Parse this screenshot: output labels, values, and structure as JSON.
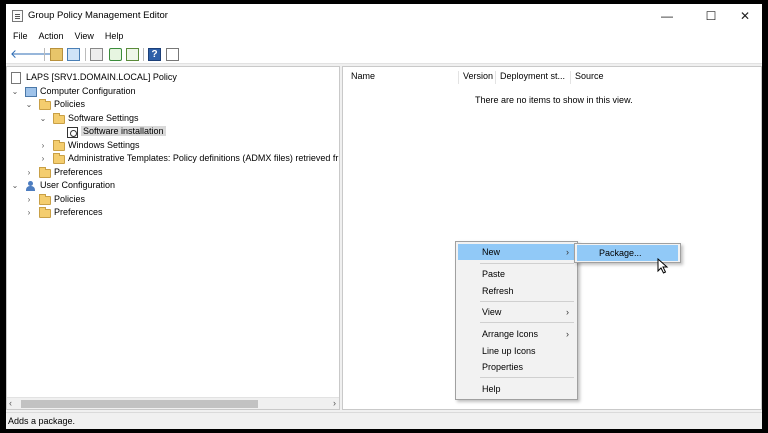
{
  "window": {
    "title": "Group Policy Management Editor",
    "controls": {
      "minimize": "—",
      "maximize": "☐",
      "close": "✕"
    }
  },
  "menubar": {
    "items": [
      "File",
      "Action",
      "View",
      "Help"
    ]
  },
  "toolbar": {
    "buttons": [
      "back-icon",
      "forward-icon",
      "up-folder-icon",
      "show-hide-tree-icon",
      "export-list-icon",
      "refresh-icon",
      "properties-icon",
      "help-icon",
      "view-icon"
    ]
  },
  "tree": {
    "items": [
      {
        "label": "LAPS [SRV1.DOMAIN.LOCAL] Policy",
        "icon": "policy-document-icon"
      },
      {
        "label": "Computer Configuration",
        "icon": "computer-icon",
        "expanded": true
      },
      {
        "label": "Policies",
        "icon": "folder-icon",
        "expanded": true
      },
      {
        "label": "Software Settings",
        "icon": "folder-icon",
        "expanded": true
      },
      {
        "label": "Software installation",
        "icon": "software-package-icon",
        "selected": true
      },
      {
        "label": "Windows Settings",
        "icon": "folder-icon",
        "expanded": false
      },
      {
        "label": "Administrative Templates: Policy definitions (ADMX files) retrieved fr",
        "icon": "folder-icon",
        "expanded": false
      },
      {
        "label": "Preferences",
        "icon": "folder-icon",
        "expanded": false
      },
      {
        "label": "User Configuration",
        "icon": "user-icon",
        "expanded": true
      },
      {
        "label": "Policies",
        "icon": "folder-icon",
        "expanded": false
      },
      {
        "label": "Preferences",
        "icon": "folder-icon",
        "expanded": false
      }
    ],
    "scroll_left": "‹",
    "scroll_right": "›"
  },
  "list": {
    "columns": [
      "Name",
      "Version",
      "Deployment st...",
      "Source"
    ],
    "empty_message": "There are no items to show in this view."
  },
  "context_menu": {
    "items": [
      {
        "label": "New",
        "submenu": true,
        "highlighted": true
      },
      {
        "label": "Paste"
      },
      {
        "label": "Refresh"
      },
      {
        "label": "View",
        "submenu": true
      },
      {
        "label": "Arrange Icons",
        "submenu": true
      },
      {
        "label": "Line up Icons"
      },
      {
        "label": "Properties"
      },
      {
        "label": "Help"
      }
    ],
    "arrow": "›"
  },
  "submenu": {
    "items": [
      {
        "label": "Package...",
        "highlighted": true
      }
    ]
  },
  "statusbar": {
    "text": "Adds a package."
  },
  "colors": {
    "highlight": "#91c9f7",
    "selection": "#d9d9d9",
    "folder": "#f4cd6e"
  }
}
